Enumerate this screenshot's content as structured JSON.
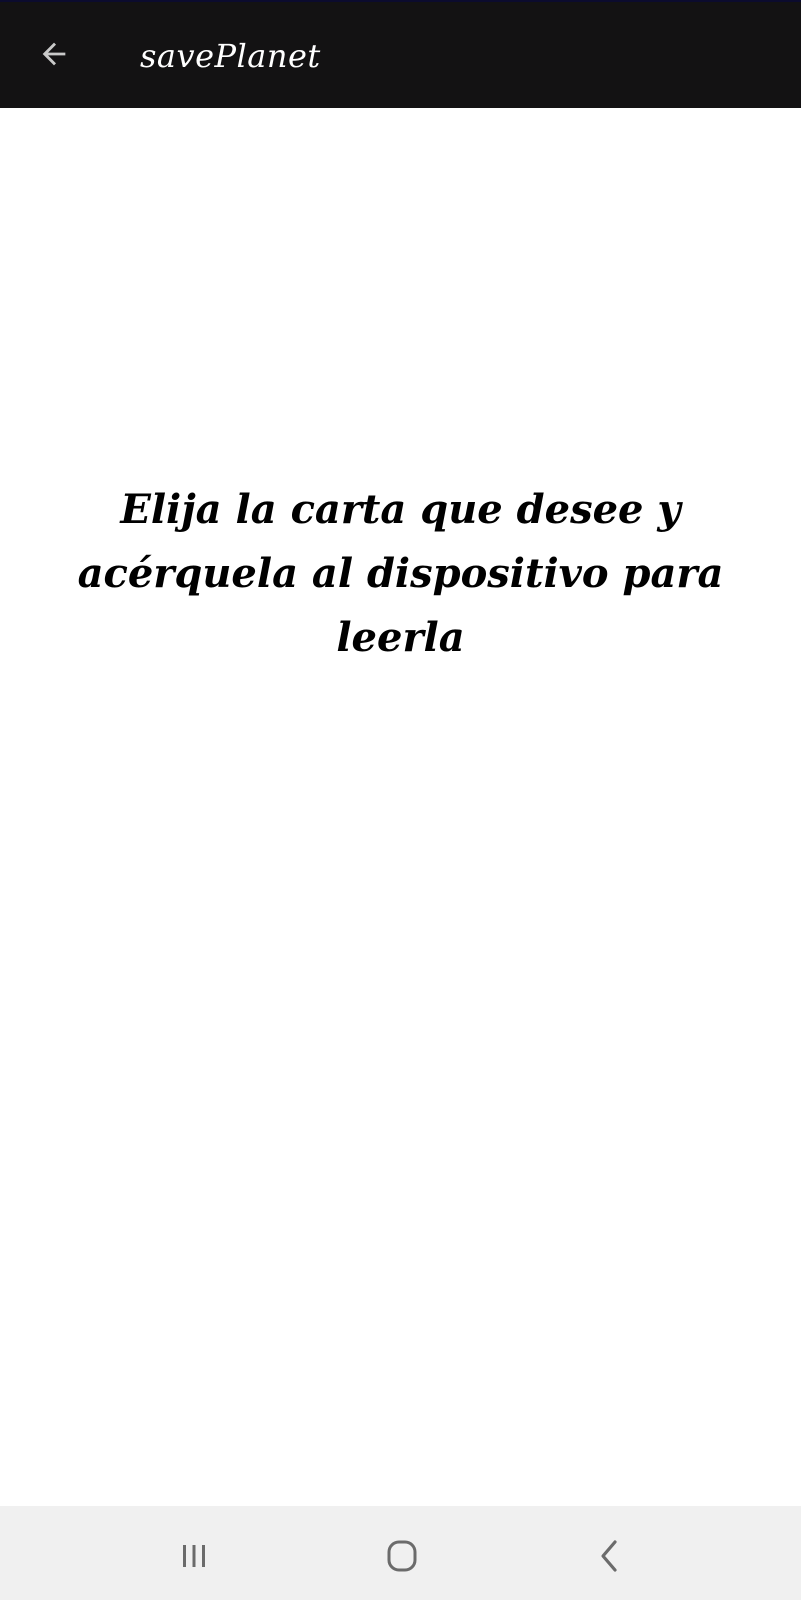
{
  "app_bar": {
    "title": "savePlanet",
    "back_icon": "arrow-left-icon",
    "background": "#131213"
  },
  "main": {
    "instruction": "Elija la carta que desee y acérquela al dispositivo para leerla"
  },
  "nav_bar": {
    "recent_icon": "recent-apps-icon",
    "home_icon": "home-icon",
    "back_icon": "back-chevron-icon",
    "background": "#f0f0f0"
  }
}
